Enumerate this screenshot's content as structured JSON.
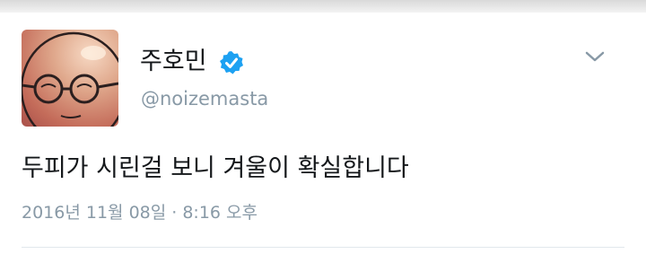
{
  "tweet": {
    "author": {
      "display_name": "주호민",
      "handle": "@noizemasta",
      "verified": true,
      "avatar_icon": "caricature-avatar"
    },
    "menu_icon": "chevron-down-icon",
    "text": "두피가 시린걸 보니 겨울이 확실합니다",
    "timestamp": "2016년 11월 08일 · 8:16 오후"
  },
  "colors": {
    "text_primary": "#14171a",
    "text_secondary": "#8899a6",
    "verified_blue": "#1da1f2",
    "divider": "#e1e8ed"
  }
}
